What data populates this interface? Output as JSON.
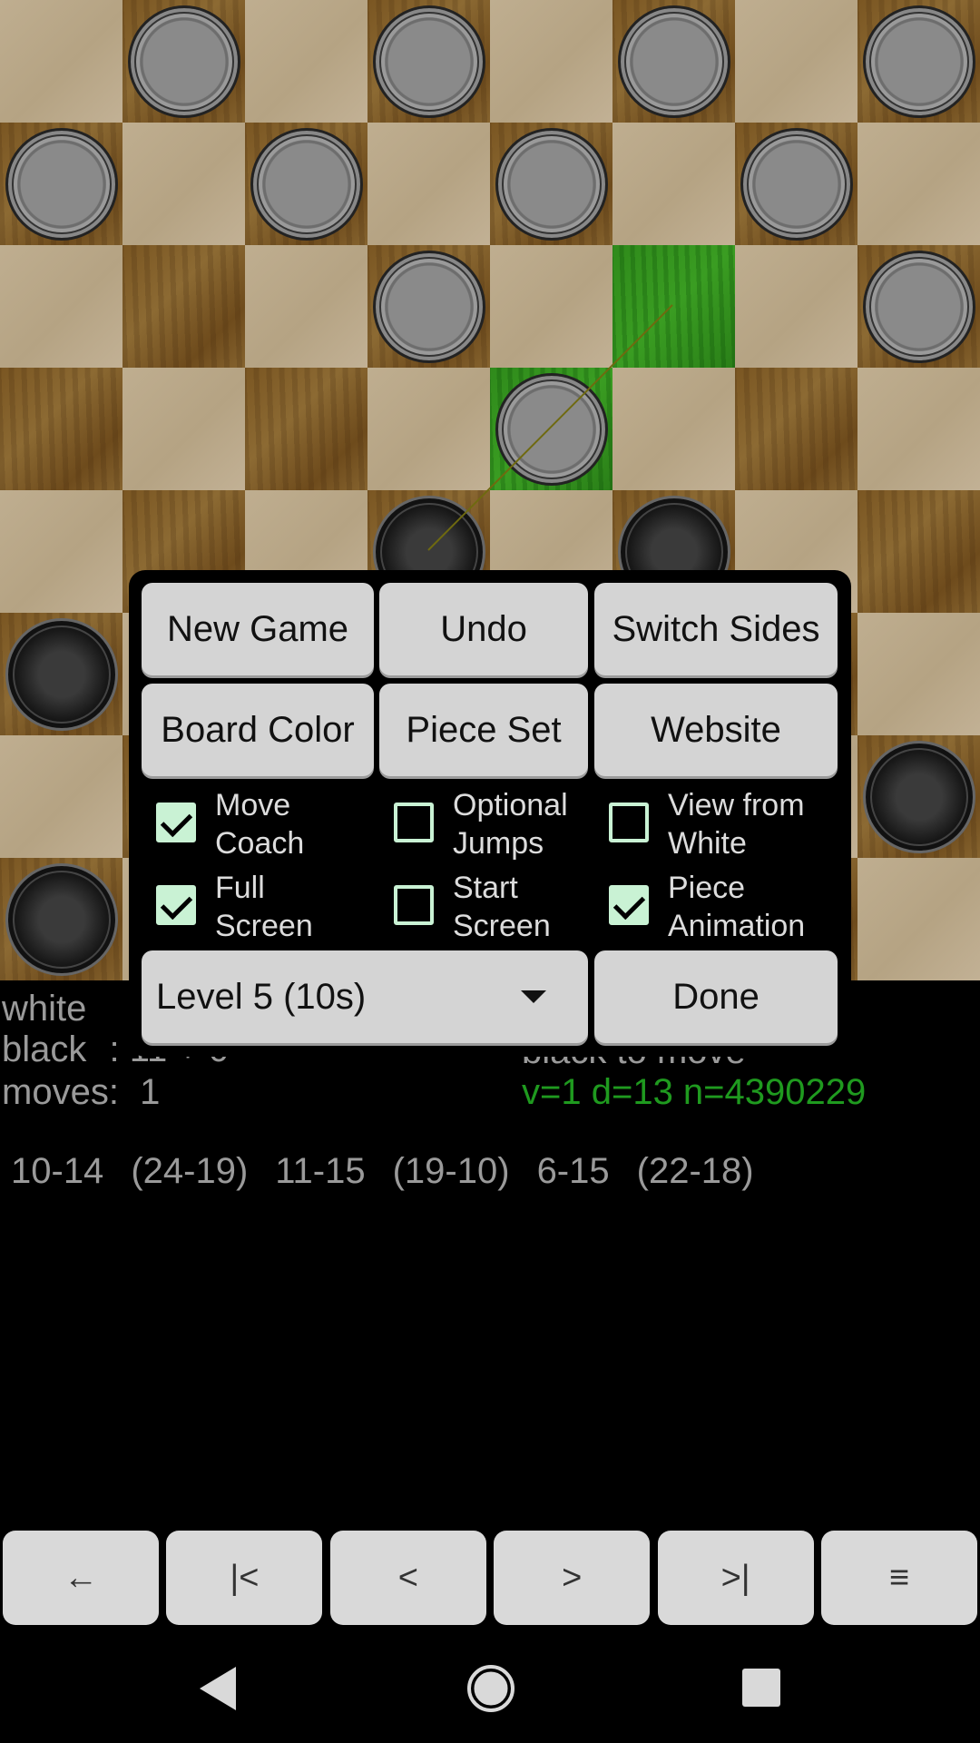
{
  "dialog": {
    "buttons": {
      "new_game": "New Game",
      "undo": "Undo",
      "switch_sides": "Switch Sides",
      "board_color": "Board Color",
      "piece_set": "Piece Set",
      "website": "Website",
      "done": "Done"
    },
    "checkboxes": [
      {
        "label_1": "Move",
        "label_2": "Coach",
        "checked": true
      },
      {
        "label_1": "Optional",
        "label_2": "Jumps",
        "checked": false
      },
      {
        "label_1": "View from",
        "label_2": "White",
        "checked": false
      },
      {
        "label_1": "Full",
        "label_2": "Screen",
        "checked": true
      },
      {
        "label_1": "Start",
        "label_2": "Screen",
        "checked": false
      },
      {
        "label_1": "Piece",
        "label_2": "Animation",
        "checked": true
      }
    ],
    "level_select": "Level 5 (10s)"
  },
  "status": {
    "white_label": "white",
    "black_label": "black",
    "black_value_partial": ": 11 + 0",
    "moves_label": "moves:",
    "moves_value": "1",
    "to_move_partial": "black to move",
    "engine_info": "v=1 d=13 n=4390229",
    "engine_color": "#1f9a1f"
  },
  "move_list": [
    "10-14",
    "(24-19)",
    "11-15",
    "(19-10)",
    "6-15",
    "(22-18)"
  ],
  "board": {
    "highlight_color": "#37961f",
    "light_pieces": [
      [
        0,
        1
      ],
      [
        0,
        3
      ],
      [
        0,
        5
      ],
      [
        0,
        7
      ],
      [
        1,
        0
      ],
      [
        1,
        2
      ],
      [
        1,
        4
      ],
      [
        1,
        6
      ],
      [
        2,
        3
      ],
      [
        2,
        7
      ],
      [
        3,
        4
      ]
    ],
    "dark_pieces": [
      [
        4,
        3
      ],
      [
        4,
        5
      ],
      [
        5,
        0
      ],
      [
        6,
        7
      ],
      [
        7,
        0
      ]
    ],
    "highlighted": [
      [
        2,
        5
      ],
      [
        3,
        4
      ]
    ]
  },
  "toolbar": {
    "icons": [
      "back-arrow-icon",
      "first-move-icon",
      "prev-move-icon",
      "next-move-icon",
      "last-move-icon",
      "menu-icon"
    ],
    "glyphs": [
      "←",
      "|<",
      "<",
      ">",
      ">|",
      "≡"
    ]
  }
}
